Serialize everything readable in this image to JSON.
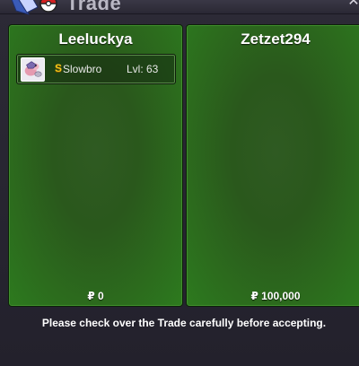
{
  "window": {
    "title": "Trade",
    "close_glyph": "✕"
  },
  "left_panel": {
    "player_name": "Leeluckya",
    "pokemon": [
      {
        "shiny_mark": "S",
        "name": "Slowbro",
        "level": "Lvl: 63",
        "icon": "pokemon-sprite-icon"
      }
    ],
    "money": "₽ 0"
  },
  "right_panel": {
    "player_name": "Zetzet294",
    "pokemon": [],
    "money": "₽ 100,000"
  },
  "notice": "Please check over the Trade carefully before accepting.",
  "colors": {
    "panel_green": "#2d7a1e",
    "shiny_gold": "#f5c518",
    "background": "#24222e"
  }
}
